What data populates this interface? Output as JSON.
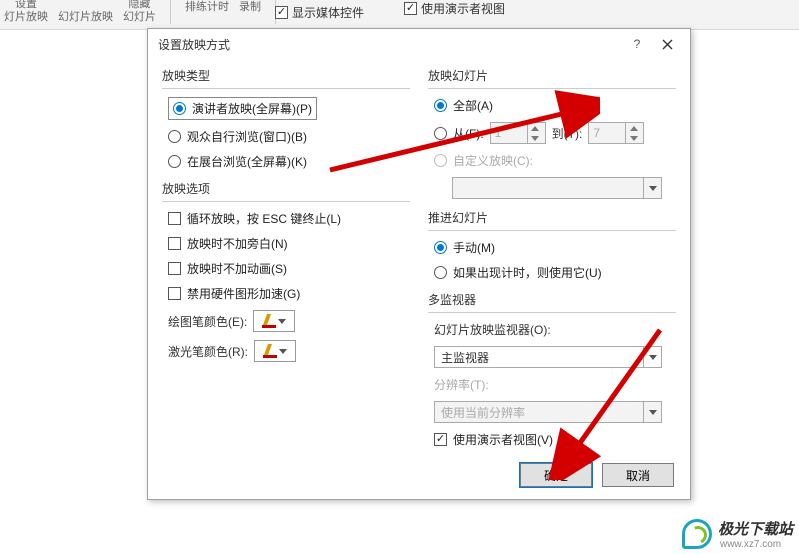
{
  "ribbon": {
    "item1": "灯片放映",
    "item2": "设置",
    "item3": "幻灯片放映",
    "item4": "隐藏",
    "item5": "幻灯片",
    "item6": "排练计时",
    "item7": "录制",
    "show_media_controls": "显示媒体控件",
    "use_presenter_view": "使用演示者视图"
  },
  "dialog_title": "设置放映方式",
  "type_group": {
    "title": "放映类型",
    "opt1": "演讲者放映(全屏幕)(P)",
    "opt1_key": "P",
    "opt2": "观众自行浏览(窗口)(B)",
    "opt3": "在展台浏览(全屏幕)(K)"
  },
  "options_group": {
    "title": "放映选项",
    "opt1": "循环放映，按 ESC 键终止(L)",
    "opt2": "放映时不加旁白(N)",
    "opt3": "放映时不加动画(S)",
    "opt4": "禁用硬件图形加速(G)",
    "pen_label": "绘图笔颜色(E):",
    "laser_label": "激光笔颜色(R):"
  },
  "slides_group": {
    "title": "放映幻灯片",
    "all": "全部(A)",
    "from": "从(F):",
    "to": "到(T):",
    "from_val": "1",
    "to_val": "7",
    "custom": "自定义放映(C):"
  },
  "advance_group": {
    "title": "推进幻灯片",
    "manual": "手动(M)",
    "timed": "如果出现计时，则使用它(U)"
  },
  "monitor_group": {
    "title": "多监视器",
    "monitor_label": "幻灯片放映监视器(O):",
    "monitor_val": "主监视器",
    "resolution_label": "分辨率(T):",
    "resolution_val": "使用当前分辨率",
    "use_presenter": "使用演示者视图(V)"
  },
  "buttons": {
    "ok": "确定",
    "cancel": "取消"
  },
  "watermark": {
    "name": "极光下载站",
    "url": "www.xz7.com"
  }
}
